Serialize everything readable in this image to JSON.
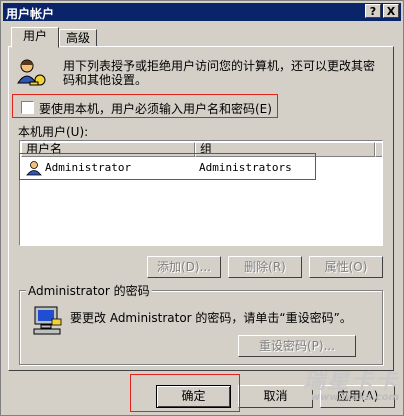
{
  "window": {
    "title": "用户帐户",
    "help_glyph": "?",
    "close_glyph": "X"
  },
  "tabs": [
    {
      "label": "用户"
    },
    {
      "label": "高级"
    }
  ],
  "intro": {
    "line1": "用下列表授予或拒绝用户访问您的计算机，还可以更改其密",
    "line2": "码和其他设置。"
  },
  "require_login": {
    "label": "要使用本机，用户必须输入用户名和密码(E)",
    "checked": false
  },
  "users_section": {
    "label": "本机用户(U):"
  },
  "table": {
    "columns": [
      "用户名",
      "组"
    ],
    "rows": [
      {
        "user": "Administrator",
        "group": "Administrators"
      }
    ]
  },
  "list_buttons": {
    "add": "添加(D)...",
    "remove": "删除(R)",
    "properties": "属性(O)"
  },
  "password_group": {
    "title": "Administrator 的密码",
    "text": "要更改 Administrator 的密码，请单击“重设密码”。",
    "reset_button": "重设密码(P)..."
  },
  "footer": {
    "ok": "确定",
    "cancel": "取消",
    "apply": "应用(A)"
  },
  "watermark": {
    "line1": "瑞星卡卡",
    "line2": "www.ikaka.com"
  },
  "colors": {
    "titlebar": "#0a246a",
    "face": "#d4d0c8",
    "highlight": "#e0241c"
  },
  "icons": {
    "users_icon": "users-key-icon",
    "user_row_icon": "user-icon",
    "computer_icon": "computer-icon"
  }
}
